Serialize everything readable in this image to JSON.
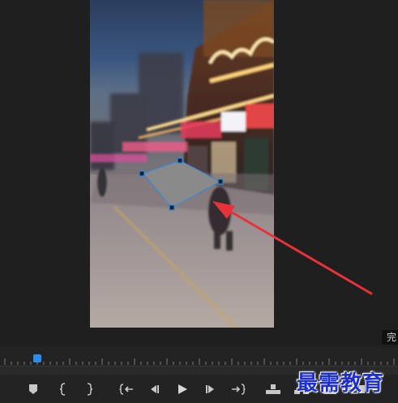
{
  "monitor": {
    "complete_label": "完"
  },
  "watermark": {
    "text": "最需教育"
  },
  "toolbar": {
    "buttons": [
      {
        "name": "add-marker-button",
        "icon": "marker-icon"
      },
      {
        "name": "mark-in-button",
        "icon": "mark-in-icon"
      },
      {
        "name": "mark-out-button",
        "icon": "mark-out-icon"
      },
      {
        "name": "go-to-in-button",
        "icon": "go-to-in-icon"
      },
      {
        "name": "step-back-button",
        "icon": "step-back-icon"
      },
      {
        "name": "play-button",
        "icon": "play-icon"
      },
      {
        "name": "step-forward-button",
        "icon": "step-forward-icon"
      },
      {
        "name": "go-to-out-button",
        "icon": "go-to-out-icon"
      },
      {
        "name": "lift-button",
        "icon": "lift-icon"
      },
      {
        "name": "extract-button",
        "icon": "extract-icon"
      },
      {
        "name": "export-frame-button",
        "icon": "camera-icon"
      },
      {
        "name": "comparison-view-button",
        "icon": "comparison-icon"
      }
    ]
  },
  "colors": {
    "accent": "#2d8ceb",
    "arrow": "#e8323a",
    "watermark": "#1e2fd0",
    "shape_fill": "#8a8a8a"
  }
}
